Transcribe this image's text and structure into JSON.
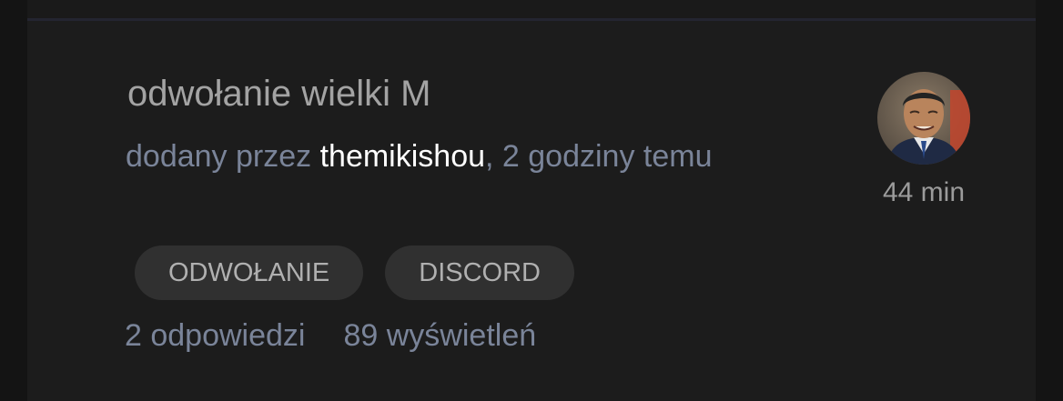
{
  "thread": {
    "title": "odwołanie wielki M",
    "added_by_prefix": "dodany przez ",
    "author": "themikishou",
    "time_suffix": ", 2 godziny temu",
    "duration": "44 min",
    "tags": [
      "ODWOŁANIE",
      "DISCORD"
    ],
    "replies": "2 odpowiedzi",
    "views": "89 wyświetleń"
  },
  "colors": {
    "background": "#141414",
    "card": "#1c1c1c",
    "title": "#a3a3a3",
    "muted_blue": "#7a8499",
    "author": "#ffffff",
    "tag_bg": "#303030",
    "tag_text": "#b0b0b0"
  },
  "icons": {
    "avatar": "user-avatar-photo"
  }
}
